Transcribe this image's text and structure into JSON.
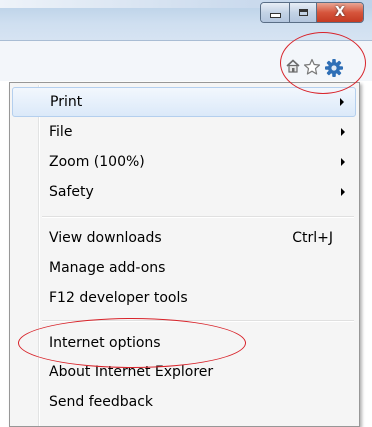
{
  "window": {
    "caption_buttons": {
      "minimize_icon": "minimize-icon",
      "maximize_icon": "maximize-icon",
      "close_glyph": "X"
    }
  },
  "toolbar": {
    "icons": [
      "home-icon",
      "star-icon",
      "gear-icon"
    ]
  },
  "tools_menu": {
    "groups": [
      [
        {
          "label": "Print",
          "submenu": true
        },
        {
          "label": "File",
          "submenu": true
        },
        {
          "label": "Zoom (100%)",
          "submenu": true
        },
        {
          "label": "Safety",
          "submenu": true
        }
      ],
      [
        {
          "label": "View downloads",
          "shortcut": "Ctrl+J"
        },
        {
          "label": "Manage add-ons"
        },
        {
          "label": "F12 developer tools"
        }
      ],
      [
        {
          "label": "Internet options"
        },
        {
          "label": "About Internet Explorer"
        },
        {
          "label": "Send feedback"
        }
      ]
    ],
    "highlighted": "Print"
  },
  "annotations": {
    "color": "#d8232a",
    "circled": [
      "star-and-gear-icons",
      "Internet options"
    ]
  },
  "colors": {
    "close_button": "#c43a22",
    "menu_background": "#f5f5f5",
    "highlight": "#dbe9f9"
  }
}
